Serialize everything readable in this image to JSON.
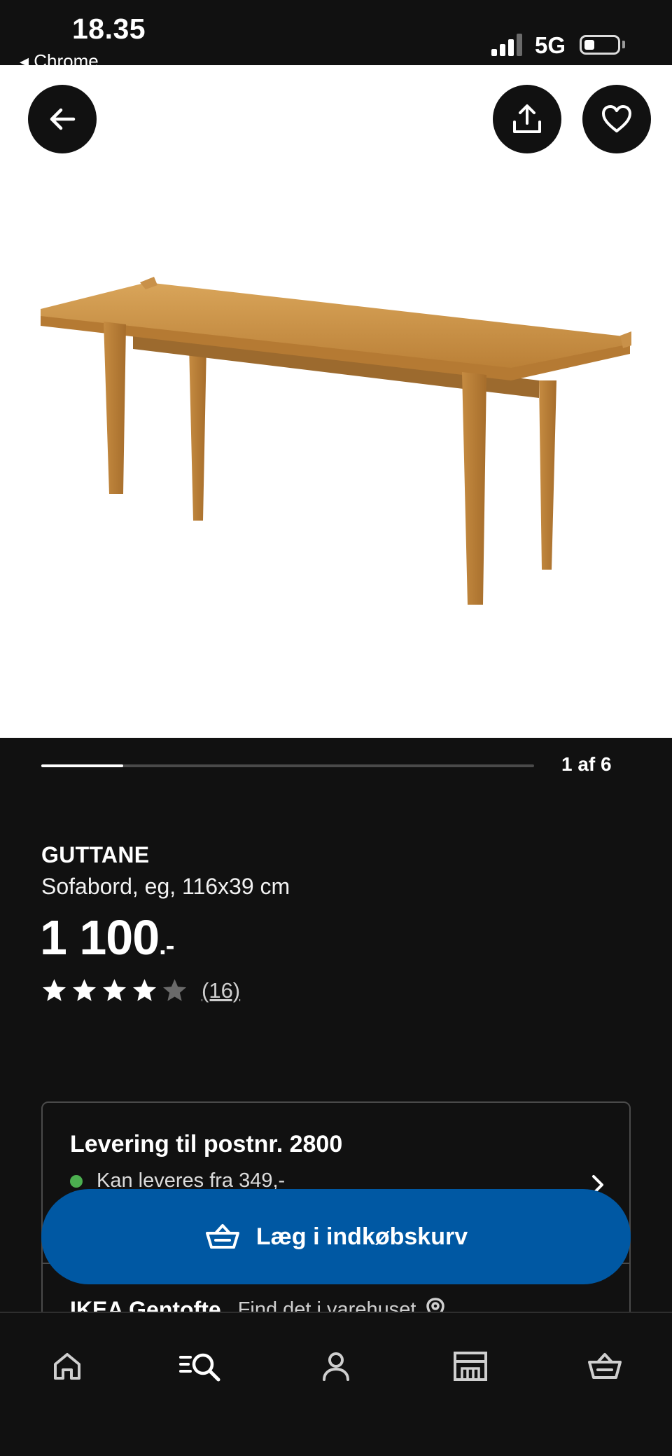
{
  "status_bar": {
    "time": "18.35",
    "back_app": "◂ Chrome",
    "network": "5G"
  },
  "hero": {
    "image_alt": "GUTTANE oak coffee table"
  },
  "carousel": {
    "counter": "1 af 6",
    "progress_fraction": 0.1667
  },
  "product": {
    "name": "GUTTANE",
    "description": "Sofabord, eg, 116x39 cm",
    "price": "1 100",
    "price_suffix": ".-",
    "rating": 4,
    "rating_max": 5,
    "review_count": "(16)"
  },
  "delivery": {
    "title": "Levering til postnr. 2800",
    "status": "Kan leveres fra 349,-",
    "status_color": "#4caf50"
  },
  "store": {
    "name": "IKEA Gentofte",
    "hint": "Find det i varehuset"
  },
  "cart_button": {
    "label": "Læg i indkøbskurv",
    "color": "#0058a3"
  },
  "bottom_nav": {
    "items": [
      "home-icon",
      "search-icon",
      "profile-icon",
      "store-icon",
      "cart-icon"
    ]
  }
}
